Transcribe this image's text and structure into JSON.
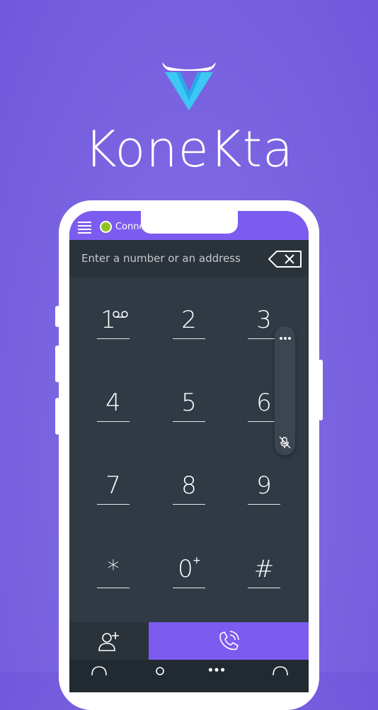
{
  "brand": {
    "name": "KoneKta"
  },
  "status": {
    "connection_text": "Connected",
    "connection_color": "#8fc31f"
  },
  "colors": {
    "background": "#7a63e0",
    "accent": "#7c5cf0",
    "screen": "#2f3a44",
    "white": "#ffffff"
  },
  "address_bar": {
    "placeholder": "Enter a number or an address",
    "value": ""
  },
  "keypad": {
    "keys": [
      {
        "digit": "1",
        "sup": "voicemail-icon"
      },
      {
        "digit": "2",
        "sup": ""
      },
      {
        "digit": "3",
        "sup": ""
      },
      {
        "digit": "4",
        "sup": ""
      },
      {
        "digit": "5",
        "sup": ""
      },
      {
        "digit": "6",
        "sup": ""
      },
      {
        "digit": "7",
        "sup": ""
      },
      {
        "digit": "8",
        "sup": ""
      },
      {
        "digit": "9",
        "sup": ""
      },
      {
        "digit": "*",
        "sup": ""
      },
      {
        "digit": "0",
        "sup": "+"
      },
      {
        "digit": "#",
        "sup": ""
      }
    ]
  },
  "icons": {
    "menu": "hamburger-menu-icon",
    "backspace": "backspace-icon",
    "more": "more-dots-icon",
    "mute": "mic-off-icon",
    "add_contact": "add-contact-icon",
    "call": "phone-call-icon"
  }
}
